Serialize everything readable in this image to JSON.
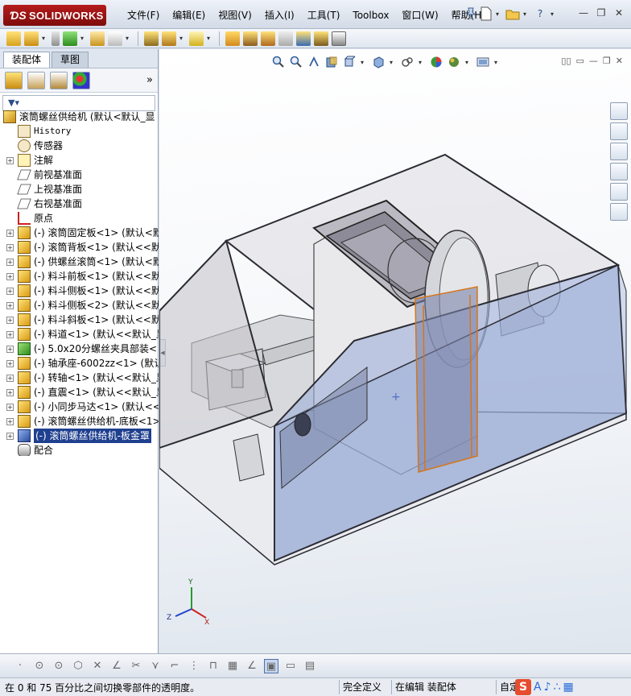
{
  "app": {
    "logo_text": "SOLIDWORKS",
    "menu": [
      "文件(F)",
      "编辑(E)",
      "视图(V)",
      "插入(I)",
      "工具(T)",
      "Toolbox",
      "窗口(W)",
      "帮助(H)"
    ],
    "window_buttons": [
      "—",
      "❐",
      "✕"
    ],
    "title_tools": [
      "?",
      "▾",
      "—"
    ]
  },
  "panel": {
    "tabs": [
      "装配体",
      "草图"
    ],
    "more_glyph": "»",
    "filter_glyph": "▼▾",
    "tree": [
      {
        "label": "滚筒螺丝供给机  (默认<默认_显",
        "icon": "assembly-icon",
        "indent": 0,
        "expander": false
      },
      {
        "label": "History",
        "icon": "history-icon",
        "indent": 1,
        "expander": false,
        "mono": true
      },
      {
        "label": "传感器",
        "icon": "sensor-icon",
        "indent": 1,
        "expander": false
      },
      {
        "label": "注解",
        "icon": "annotation-icon",
        "indent": 1,
        "expander": true
      },
      {
        "label": "前视基准面",
        "icon": "plane-icon",
        "indent": 1,
        "expander": false
      },
      {
        "label": "上视基准面",
        "icon": "plane-icon",
        "indent": 1,
        "expander": false
      },
      {
        "label": "右视基准面",
        "icon": "plane-icon",
        "indent": 1,
        "expander": false
      },
      {
        "label": "原点",
        "icon": "origin-icon",
        "indent": 1,
        "expander": false
      },
      {
        "label": "(-) 滚筒固定板<1> (默认<默",
        "icon": "part-icon",
        "indent": 1,
        "expander": true
      },
      {
        "label": "(-) 滚筒背板<1> (默认<<默认",
        "icon": "part-icon",
        "indent": 1,
        "expander": true
      },
      {
        "label": "(-) 供螺丝滚筒<1> (默认<默",
        "icon": "part-icon",
        "indent": 1,
        "expander": true
      },
      {
        "label": "(-) 料斗前板<1> (默认<<默认",
        "icon": "part-icon",
        "indent": 1,
        "expander": true
      },
      {
        "label": "(-) 料斗侧板<1> (默认<<默认",
        "icon": "part-icon",
        "indent": 1,
        "expander": true
      },
      {
        "label": "(-) 料斗侧板<2> (默认<<默认",
        "icon": "part-icon",
        "indent": 1,
        "expander": true
      },
      {
        "label": "(-) 料斗斜板<1> (默认<<默认",
        "icon": "part-icon",
        "indent": 1,
        "expander": true
      },
      {
        "label": "(-) 料道<1> (默认<<默认_显",
        "icon": "part-icon",
        "indent": 1,
        "expander": true
      },
      {
        "label": "(-) 5.0x20分螺丝夹具部装<",
        "icon": "subassembly-icon",
        "indent": 1,
        "expander": true
      },
      {
        "label": "(-) 轴承座-6002zz<1> (默认",
        "icon": "part-icon",
        "indent": 1,
        "expander": true
      },
      {
        "label": "(-) 转轴<1> (默认<<默认_显",
        "icon": "part-icon",
        "indent": 1,
        "expander": true
      },
      {
        "label": "(-) 直震<1> (默认<<默认_显",
        "icon": "part-icon",
        "indent": 1,
        "expander": true
      },
      {
        "label": "(-) 小同步马达<1> (默认<<默",
        "icon": "part-icon",
        "indent": 1,
        "expander": true
      },
      {
        "label": "(-) 滚筒螺丝供给机-底板<1>",
        "icon": "part-icon",
        "indent": 1,
        "expander": true
      },
      {
        "label": "(-) 滚筒螺丝供给机-板金罩",
        "icon": "part-selected-icon",
        "indent": 1,
        "expander": true,
        "selected": true
      },
      {
        "label": "配合",
        "icon": "mates-icon",
        "indent": 1,
        "expander": false
      }
    ]
  },
  "sketchbar": {
    "icons": [
      "·",
      "⊙",
      "⊙",
      "⬡",
      "✕",
      "∠",
      "✂",
      "⋎",
      "⌐",
      "⋮",
      "⊓",
      "▦",
      "∠",
      "▣",
      "▭",
      "▤"
    ]
  },
  "status": {
    "message": "在 0 和 75 百分比之间切换零部件的透明度。",
    "cells": [
      "完全定义",
      "在编辑 装配体",
      "自定"
    ],
    "ime_logo": "S",
    "ime_glyphs": [
      "A",
      "♪",
      "∴",
      "▦",
      "⚙"
    ]
  },
  "colors": {
    "selection": "#1f3f8f",
    "enclosure_fill": "#9fb0d8",
    "edge": "#2b2b33",
    "orange_edge": "#d4761e"
  },
  "triad": {
    "x": "X",
    "y": "Y",
    "z": "Z"
  }
}
